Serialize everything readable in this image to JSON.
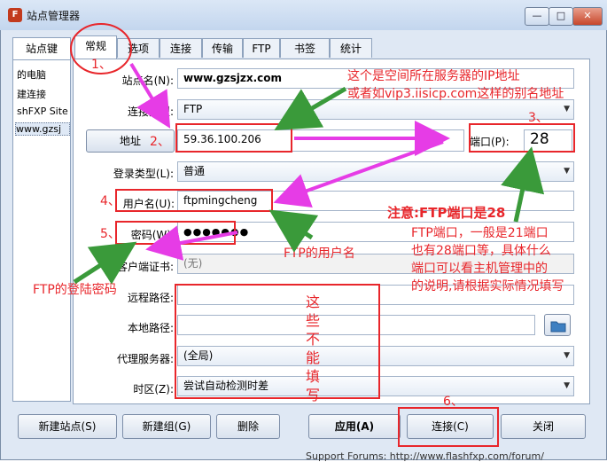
{
  "window": {
    "title": "站点管理器",
    "min_label": "—",
    "max_label": "□",
    "close_label": "✕"
  },
  "left_panel": {
    "tab_label": "站点",
    "tab_overlay_label": "键",
    "items": [
      "的电脑",
      "建连接",
      "shFXP Site",
      "www.gzsj"
    ]
  },
  "tabs": [
    "常规",
    "选项",
    "连接",
    "传输",
    "FTP",
    "书签",
    "统计"
  ],
  "form": {
    "site_name": {
      "label": "站点名(N):",
      "value": "www.gzsjzx.com"
    },
    "conn_type": {
      "label": "连接类型:",
      "value": "FTP"
    },
    "address": {
      "button": "地址",
      "value": "59.36.100.206"
    },
    "port": {
      "label": "端口(P):",
      "value": "28"
    },
    "login_type": {
      "label": "登录类型(L):",
      "value": "普通"
    },
    "username": {
      "label": "用户名(U):",
      "value": "ftpmingcheng"
    },
    "password": {
      "label": "密码(W):",
      "value": "●●●●●●●"
    },
    "client_cert": {
      "label": "客户端证书:",
      "value": "(无)"
    },
    "remote_path": {
      "label": "远程路径:",
      "value": ""
    },
    "local_path": {
      "label": "本地路径:",
      "value": ""
    },
    "proxy": {
      "label": "代理服务器:",
      "value": "(全局)"
    },
    "timezone": {
      "label": "时区(Z):",
      "value": "尝试自动检测时差"
    }
  },
  "buttons": {
    "new_site": "新建站点(S)",
    "new_group": "新建组(G)",
    "delete": "删除",
    "apply": "应用(A)",
    "connect": "连接(C)",
    "close": "关闭"
  },
  "annotations": {
    "n1": "1、",
    "n2": "2、",
    "n3": "3、",
    "n4": "4、",
    "n5": "5、",
    "n6": "6、",
    "ip_note_line1": "这个是空间所在服务器的IP地址",
    "ip_note_line2": "或者如vip3.iisicp.com这样的别名地址",
    "port_note_title": "注意:FTP端口是28",
    "port_note_lines": [
      "FTP端口，一般是21端口",
      "也有28端口等，具体什么",
      "端口可以看主机管理中的",
      "的说明,请根据实际情况填写"
    ],
    "user_note": "FTP的用户名",
    "pass_note": "FTP的登陆密码",
    "no_fill_note": "这些不能填写"
  },
  "footer_text": "Support Forums: http://www.flashfxp.com/forum/",
  "colors": {
    "annotation_red": "#e8262b",
    "arrow_green": "#3a9a3a",
    "arrow_magenta": "#e63ce6"
  }
}
